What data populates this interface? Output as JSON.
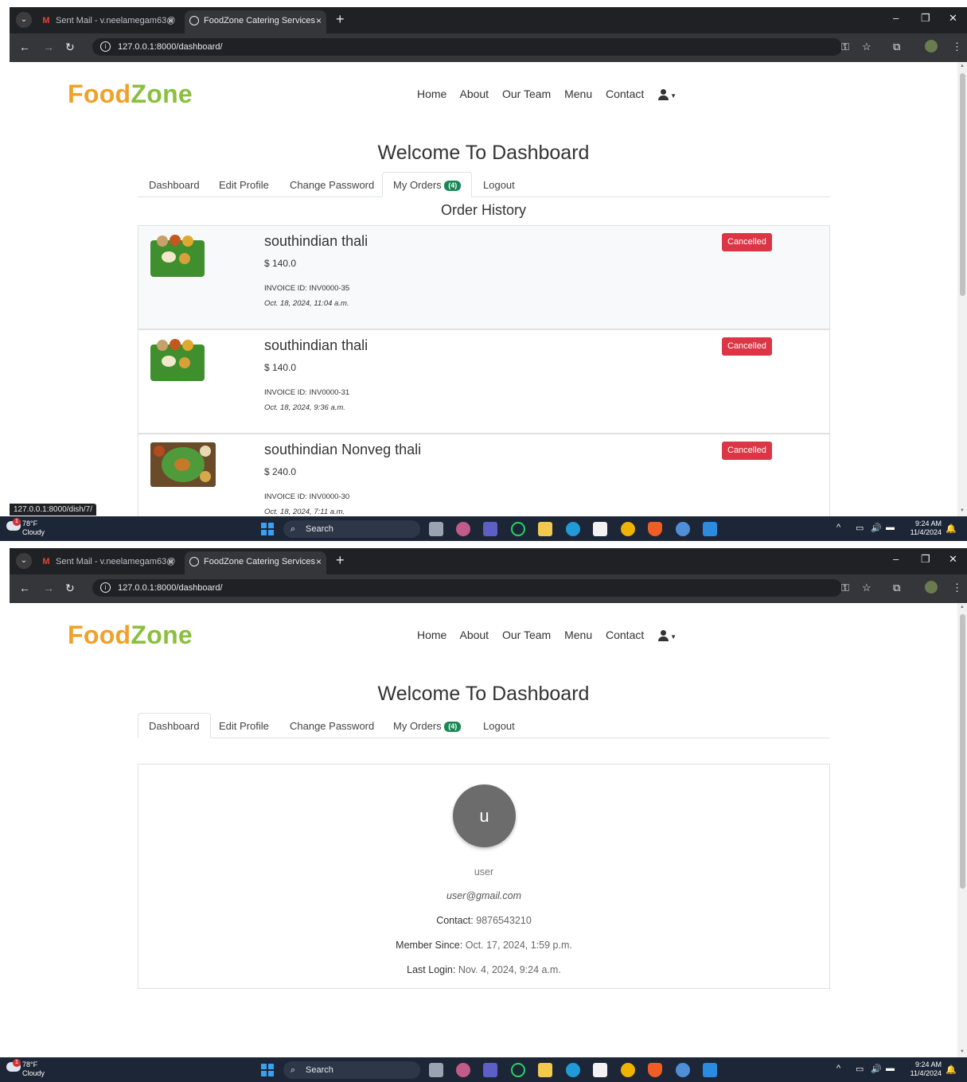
{
  "browser": {
    "tabs": [
      {
        "title": "Sent Mail - v.neelamegam63@",
        "icon": "gmail-icon"
      },
      {
        "title": "FoodZone Catering Services",
        "icon": "globe-icon"
      }
    ],
    "url": "127.0.0.1:8000/dashboard/",
    "hover_url": "127.0.0.1:8000/dish/7/"
  },
  "site": {
    "brand_part1": "Food",
    "brand_part2": "Zone",
    "brand_colors": {
      "food": "#f0a12a",
      "zone": "#8bbf3f"
    },
    "nav": [
      "Home",
      "About",
      "Our Team",
      "Menu",
      "Contact"
    ]
  },
  "dashboard": {
    "welcome": "Welcome To Dashboard",
    "tabs": {
      "dashboard": "Dashboard",
      "edit_profile": "Edit Profile",
      "change_password": "Change Password",
      "my_orders": "My Orders",
      "orders_count": "(4)",
      "logout": "Logout"
    }
  },
  "orders": {
    "heading": "Order History",
    "items": [
      {
        "dish": "southindian thali",
        "price": "$ 140.0",
        "invoice": "INVOICE ID: INV0000-35",
        "date": "Oct. 18, 2024, 11:04 a.m.",
        "status": "Cancelled"
      },
      {
        "dish": "southindian thali",
        "price": "$ 140.0",
        "invoice": "INVOICE ID: INV0000-31",
        "date": "Oct. 18, 2024, 9:36 a.m.",
        "status": "Cancelled"
      },
      {
        "dish": "southindian Nonveg thali",
        "price": "$ 240.0",
        "invoice": "INVOICE ID: INV0000-30",
        "date": "Oct. 18, 2024, 7:11 a.m.",
        "status": "Cancelled"
      }
    ],
    "status_color": "#dc3545"
  },
  "profile": {
    "initial": "u",
    "username": "user",
    "email": "user@gmail.com",
    "contact_label": "Contact:",
    "contact": "9876543210",
    "member_since_label": "Member Since:",
    "member_since": "Oct. 17, 2024, 1:59 p.m.",
    "last_login_label": "Last Login:",
    "last_login": "Nov. 4, 2024, 9:24 a.m."
  },
  "taskbar": {
    "temp": "78°F",
    "weather": "Cloudy",
    "alert_count": "1",
    "search": "Search",
    "time": "9:24 AM",
    "date": "11/4/2024"
  }
}
